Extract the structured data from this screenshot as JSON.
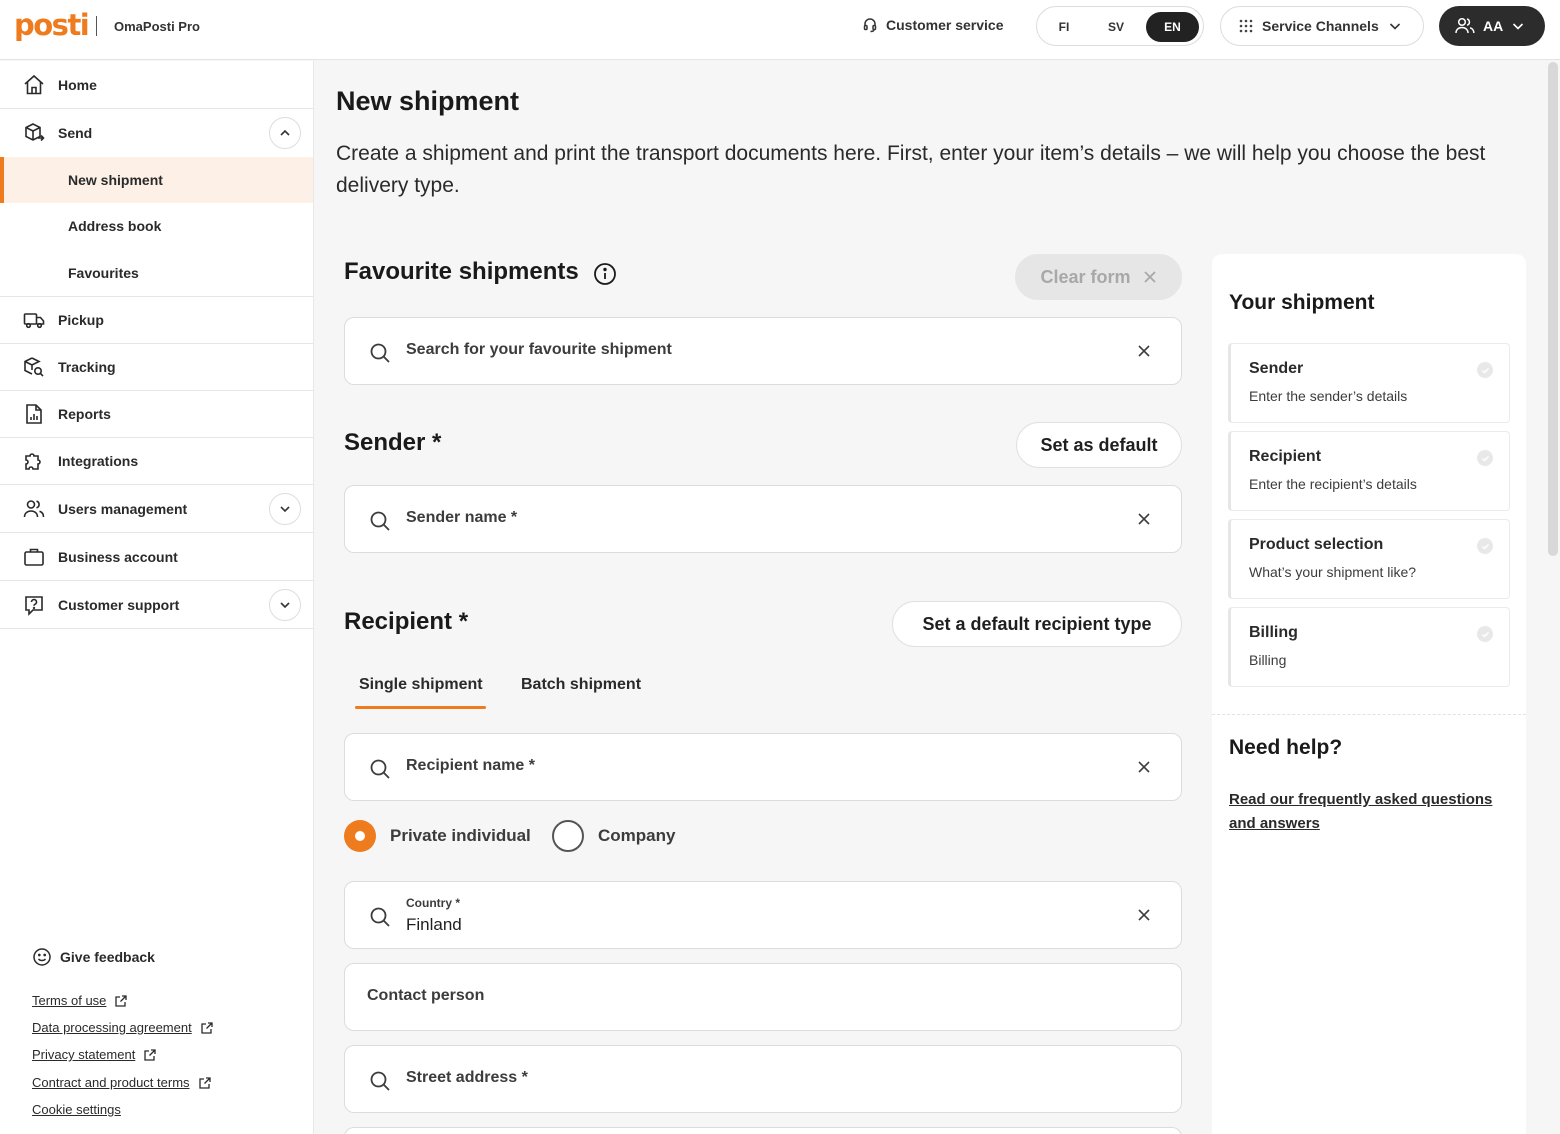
{
  "header": {
    "logo": "posti",
    "app_name": "OmaPosti Pro",
    "customer_service": "Customer service",
    "languages": [
      "FI",
      "SV",
      "EN"
    ],
    "selected_language": "EN",
    "service_channels": "Service Channels",
    "user_initials": "AA"
  },
  "sidebar": {
    "home": "Home",
    "send": "Send",
    "send_items": [
      "New shipment",
      "Address book",
      "Favourites"
    ],
    "pickup": "Pickup",
    "tracking": "Tracking",
    "reports": "Reports",
    "integrations": "Integrations",
    "users_management": "Users management",
    "business_account": "Business account",
    "customer_support": "Customer support",
    "give_feedback": "Give feedback",
    "footer_links": [
      "Terms of use",
      "Data processing agreement",
      "Privacy statement",
      "Contract and product terms",
      "Cookie settings"
    ]
  },
  "main": {
    "title": "New shipment",
    "intro": "Create a shipment and print the transport documents here. First, enter your item’s details – we will help you choose the best delivery type.",
    "favourites": {
      "title": "Favourite shipments",
      "clear_form": "Clear form",
      "search_placeholder": "Search for your favourite shipment"
    },
    "sender": {
      "title": "Sender",
      "required_mark": "*",
      "set_default": "Set as default",
      "name_placeholder": "Sender name *"
    },
    "recipient": {
      "title": "Recipient",
      "required_mark": "*",
      "set_default_type": "Set a default recipient type",
      "tabs": [
        "Single shipment",
        "Batch shipment"
      ],
      "active_tab": "Single shipment",
      "name_placeholder": "Recipient name *",
      "radio_options": [
        "Private individual",
        "Company"
      ],
      "selected_radio": "Private individual",
      "country_label": "Country *",
      "country_value": "Finland",
      "contact_placeholder": "Contact person",
      "street_placeholder": "Street address *"
    }
  },
  "right_panel": {
    "title": "Your shipment",
    "steps": [
      {
        "title": "Sender",
        "desc": "Enter the sender’s details"
      },
      {
        "title": "Recipient",
        "desc": "Enter the recipient’s details"
      },
      {
        "title": "Product selection",
        "desc": "What’s your shipment like?"
      },
      {
        "title": "Billing",
        "desc": "Billing"
      }
    ],
    "help_title": "Need help?",
    "help_link": "Read our frequently asked questions and answers"
  },
  "colors": {
    "accent": "#ee7b1e",
    "active_bg": "#fdf1e7",
    "dark": "#2c2c2c"
  }
}
